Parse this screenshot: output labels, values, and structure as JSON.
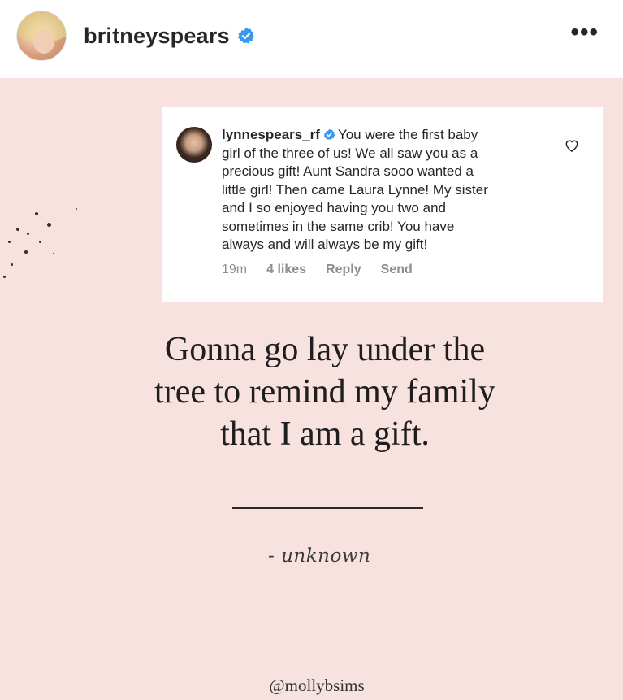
{
  "header": {
    "username": "britneyspears",
    "more_label": "•••",
    "avatar_icon": "profile-photo",
    "verified_icon": "verified-badge-icon",
    "accent": "#3897f0"
  },
  "comment": {
    "username": "lynnespears_rf",
    "text_lines": [
      "You were the first baby",
      "girl of the three of us! We all saw you as a",
      "precious gift! Aunt Sandra sooo wanted a",
      "little girl! Then came Laura Lynne! My sister",
      "and I so enjoyed having you two and",
      "sometimes in the same crib! You have",
      "always and will always be my gift!"
    ],
    "time": "19m",
    "likes": "4 likes",
    "reply": "Reply",
    "send": "Send",
    "like_icon": "heart-icon"
  },
  "quote": {
    "lines": [
      "Gonna go lay under the",
      "tree to remind my family",
      "that I am a gift."
    ],
    "attribution": "- unknown",
    "handle": "@mollybsims"
  },
  "colors": {
    "background": "#f8e2df",
    "card": "#ffffff",
    "text": "#262626",
    "meta": "#8e8e8e"
  }
}
